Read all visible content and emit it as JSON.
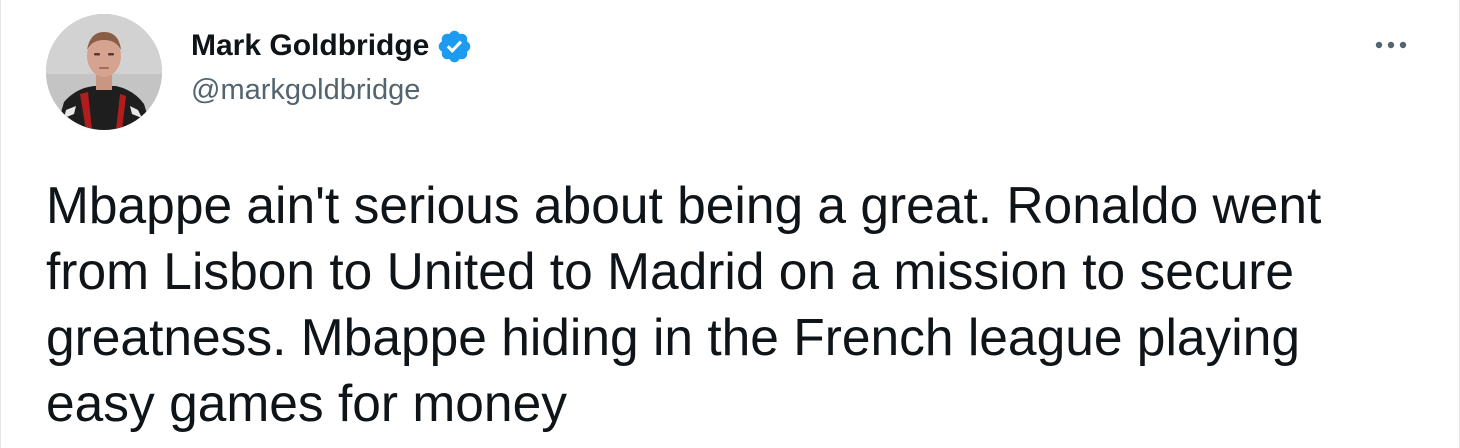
{
  "author": {
    "display_name": "Mark Goldbridge",
    "handle": "@markgoldbridge",
    "verified": true,
    "verified_color": "#1d9bf0",
    "avatar_icon": "user-avatar"
  },
  "menu": {
    "icon": "more-horizontal-icon"
  },
  "tweet": {
    "text": "Mbappe ain't serious about being a great. Ronaldo went from Lisbon to United to Madrid on a mission to secure greatness. Mbappe hiding in the French league playing easy games for money"
  },
  "colors": {
    "text_primary": "#0f1419",
    "text_secondary": "#536471",
    "background": "#ffffff"
  }
}
